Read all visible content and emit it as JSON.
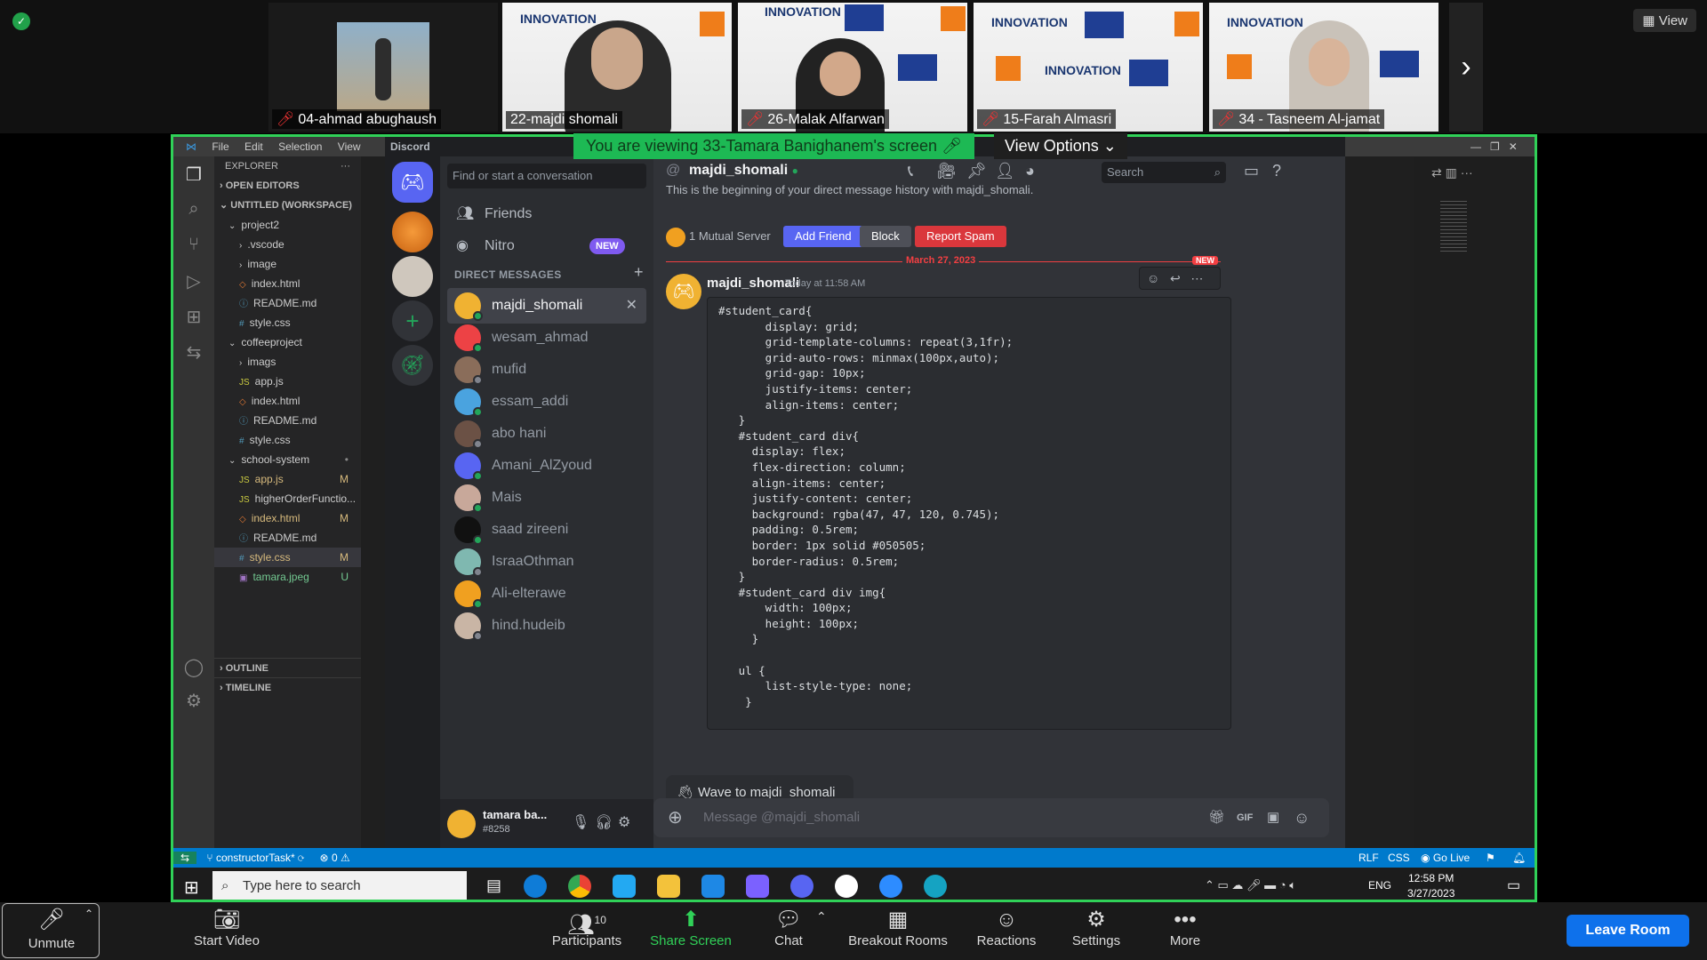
{
  "zoom": {
    "view_label": "View",
    "viewing_banner": "You are viewing 33-Tamara Banighanem's screen",
    "view_options": "View Options",
    "participants": [
      {
        "name": "04-ahmad abughaush"
      },
      {
        "name": "22-majdi shomali"
      },
      {
        "name": "26-Malak Alfarwan"
      },
      {
        "name": "15-Farah Almasri"
      },
      {
        "name": "34 - Tasneem Al-jamat"
      }
    ],
    "tile_logo": "INNOVATION",
    "toolbar": {
      "unmute": "Unmute",
      "start_video": "Start Video",
      "participants": "Participants",
      "participants_count": "10",
      "share_screen": "Share Screen",
      "chat": "Chat",
      "breakout": "Breakout Rooms",
      "reactions": "Reactions",
      "settings": "Settings",
      "more": "More",
      "leave": "Leave Room"
    }
  },
  "vscode": {
    "menu": [
      "File",
      "Edit",
      "Selection",
      "View"
    ],
    "explorer_title": "EXPLORER",
    "open_editors": "OPEN EDITORS",
    "workspace": "UNTITLED (WORKSPACE)",
    "tree": [
      {
        "label": "project2",
        "depth": 1,
        "kind": "folder-open"
      },
      {
        "label": ".vscode",
        "depth": 2,
        "kind": "folder"
      },
      {
        "label": "image",
        "depth": 2,
        "kind": "folder"
      },
      {
        "label": "index.html",
        "depth": 2,
        "kind": "html"
      },
      {
        "label": "README.md",
        "depth": 2,
        "kind": "info"
      },
      {
        "label": "style.css",
        "depth": 2,
        "kind": "css"
      },
      {
        "label": "coffeeproject",
        "depth": 1,
        "kind": "folder-open"
      },
      {
        "label": "imags",
        "depth": 2,
        "kind": "folder"
      },
      {
        "label": "app.js",
        "depth": 2,
        "kind": "js"
      },
      {
        "label": "index.html",
        "depth": 2,
        "kind": "html"
      },
      {
        "label": "README.md",
        "depth": 2,
        "kind": "info"
      },
      {
        "label": "style.css",
        "depth": 2,
        "kind": "css"
      },
      {
        "label": "school-system",
        "depth": 1,
        "kind": "folder-open",
        "status": "•"
      },
      {
        "label": "app.js",
        "depth": 2,
        "kind": "js",
        "status": "M"
      },
      {
        "label": "higherOrderFunctio...",
        "depth": 2,
        "kind": "js"
      },
      {
        "label": "index.html",
        "depth": 2,
        "kind": "html",
        "status": "M"
      },
      {
        "label": "README.md",
        "depth": 2,
        "kind": "info"
      },
      {
        "label": "style.css",
        "depth": 2,
        "kind": "css",
        "status": "M"
      },
      {
        "label": "tamara.jpeg",
        "depth": 2,
        "kind": "img",
        "status": "U"
      }
    ],
    "outline": "OUTLINE",
    "timeline": "TIMELINE",
    "status_branch": "constructorTask*",
    "status_errors": "0",
    "status_right": [
      "RLF",
      "CSS",
      "Go Live"
    ]
  },
  "discord": {
    "app_title": "Discord",
    "search_placeholder": "Find or start a conversation",
    "friends": "Friends",
    "nitro": "Nitro",
    "new_badge": "NEW",
    "dm_header": "DIRECT MESSAGES",
    "dms": [
      {
        "name": "majdi_shomali",
        "color": "#f0b232",
        "status": "online",
        "selected": true
      },
      {
        "name": "wesam_ahmad",
        "color": "#ed4245",
        "status": "online"
      },
      {
        "name": "mufid",
        "color": "#8a6d5a",
        "status": "offline"
      },
      {
        "name": "essam_addi",
        "color": "#4aa3df",
        "status": "online"
      },
      {
        "name": "abo hani",
        "color": "#6b5145",
        "status": "offline"
      },
      {
        "name": "Amani_AlZyoud",
        "color": "#5865f2",
        "status": "online"
      },
      {
        "name": "Mais",
        "color": "#c8a89a",
        "status": "online"
      },
      {
        "name": "saad zireeni",
        "color": "#111111",
        "status": "online"
      },
      {
        "name": "IsraaOthman",
        "color": "#7fb8b0",
        "status": "offline"
      },
      {
        "name": "Ali-elterawe",
        "color": "#f0a020",
        "status": "online"
      },
      {
        "name": "hind.hudeib",
        "color": "#c9b5a5",
        "status": "offline"
      }
    ],
    "user_name": "tamara ba...",
    "user_tag": "#8258",
    "channel_name": "majdi_shomali",
    "search": "Search",
    "history_text": "This is the beginning of your direct message history with majdi_shomali.",
    "mutual": "1 Mutual Server",
    "add_friend": "Add Friend",
    "block": "Block",
    "report": "Report Spam",
    "date_divider": "March 27, 2023",
    "new_label": "NEW",
    "msg_author": "majdi_shomali",
    "msg_time": "Today at 11:58 AM",
    "code": "#student_card{\n       display: grid;\n       grid-template-columns: repeat(3,1fr);\n       grid-auto-rows: minmax(100px,auto);\n       grid-gap: 10px;\n       justify-items: center;\n       align-items: center;\n   }\n   #student_card div{\n     display: flex;\n     flex-direction: column;\n     align-items: center;\n     justify-content: center;\n     background: rgba(47, 47, 120, 0.745);\n     padding: 0.5rem;\n     border: 1px solid #050505;\n     border-radius: 0.5rem;\n   }\n   #student_card div img{\n       width: 100px;\n       height: 100px;\n     }\n\n   ul {\n       list-style-type: none;\n    }",
    "wave": "Wave to majdi_shomali",
    "input_placeholder": "Message @majdi_shomali"
  },
  "windows": {
    "search_placeholder": "Type here to search",
    "time": "12:58 PM",
    "date": "3/27/2023",
    "lang": "ENG"
  }
}
